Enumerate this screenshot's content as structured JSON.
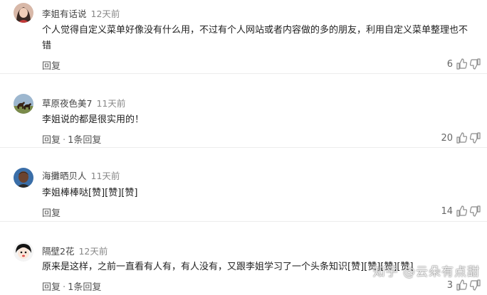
{
  "comments": [
    {
      "author": "李姐有话说",
      "time": "12天前",
      "text": "个人觉得自定义菜单好像没有什么用，不过有个人网站或者内容做的多的朋友，利用自定义菜单整理也不错",
      "reply_label": "回复",
      "more_replies": "",
      "likes": "6",
      "avatar": "avatar-woman"
    },
    {
      "author": "草原夜色美7",
      "time": "11天前",
      "text": "李姐说的都是很实用的！",
      "reply_label": "回复",
      "more_replies": "1条回复",
      "likes": "20",
      "avatar": "avatar-horses"
    },
    {
      "author": "海攤晒贝人",
      "time": "11天前",
      "text": "李姐棒棒哒[赞][赞][赞]",
      "reply_label": "回复",
      "more_replies": "",
      "likes": "14",
      "avatar": "avatar-man"
    },
    {
      "author": "隔壁2花",
      "time": "12天前",
      "text": "原来是这样，之前一直看有人有，有人没有，又跟李姐学习了一个头条知识[赞][赞][赞][赞]",
      "reply_label": "回复",
      "more_replies": "1条回复",
      "likes": "3",
      "avatar": "avatar-cartoon"
    }
  ],
  "watermark": "知乎 @云朵有点甜",
  "colors": {
    "text": "#222222",
    "meta": "#555555",
    "icon": "#8a8a8a"
  }
}
